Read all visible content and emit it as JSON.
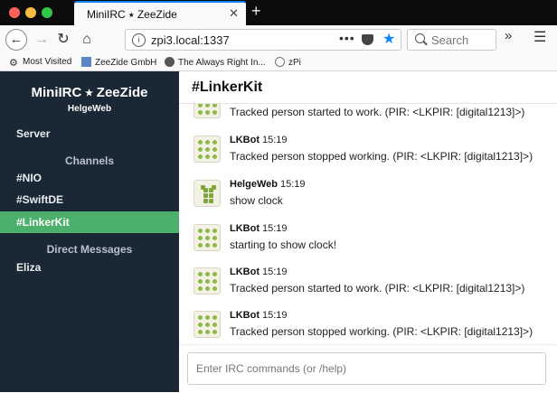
{
  "browser": {
    "tab_title": "MiniIRC ⭑ ZeeZide",
    "url": "zpi3.local:1337",
    "url_actions": "•••",
    "search_placeholder": "Search",
    "bookmarks": [
      {
        "label": "Most Visited",
        "icon": "gear-icon"
      },
      {
        "label": "ZeeZide GmbH",
        "icon": "zz-icon"
      },
      {
        "label": "The Always Right In...",
        "icon": "globe-icon"
      },
      {
        "label": "zPi",
        "icon": "globe-icon"
      }
    ],
    "colors": {
      "accent": "#0a84ff",
      "tabbar": "#0c0c0d"
    }
  },
  "sidebar": {
    "title": "MiniIRC ⭑ ZeeZide",
    "user": "HelgeWeb",
    "server_label": "Server",
    "channels_header": "Channels",
    "channels": [
      {
        "label": "#NIO",
        "active": false
      },
      {
        "label": "#SwiftDE",
        "active": false
      },
      {
        "label": "#LinkerKit",
        "active": true
      }
    ],
    "dm_header": "Direct Messages",
    "dms": [
      {
        "label": "Eliza"
      }
    ],
    "colors": {
      "background": "#1a2735",
      "active": "#4caf6b"
    }
  },
  "channel": {
    "title": "#LinkerKit"
  },
  "messages": [
    {
      "nick": "",
      "time": "",
      "text": "Tracked person started to work. (PIR: <LKPIR: [digital1213]>)",
      "avatar": "dots"
    },
    {
      "nick": "LKBot",
      "time": "15:19",
      "text": "Tracked person stopped working. (PIR: <LKPIR: [digital1213]>)",
      "avatar": "dots"
    },
    {
      "nick": "HelgeWeb",
      "time": "15:19",
      "text": "show clock",
      "avatar": "grid"
    },
    {
      "nick": "LKBot",
      "time": "15:19",
      "text": "starting to show clock!",
      "avatar": "dots"
    },
    {
      "nick": "LKBot",
      "time": "15:19",
      "text": "Tracked person started to work. (PIR: <LKPIR: [digital1213]>)",
      "avatar": "dots"
    },
    {
      "nick": "LKBot",
      "time": "15:19",
      "text": "Tracked person stopped working. (PIR: <LKPIR: [digital1213]>)",
      "avatar": "dots"
    }
  ],
  "input": {
    "placeholder": "Enter IRC commands (or /help)",
    "value": ""
  }
}
